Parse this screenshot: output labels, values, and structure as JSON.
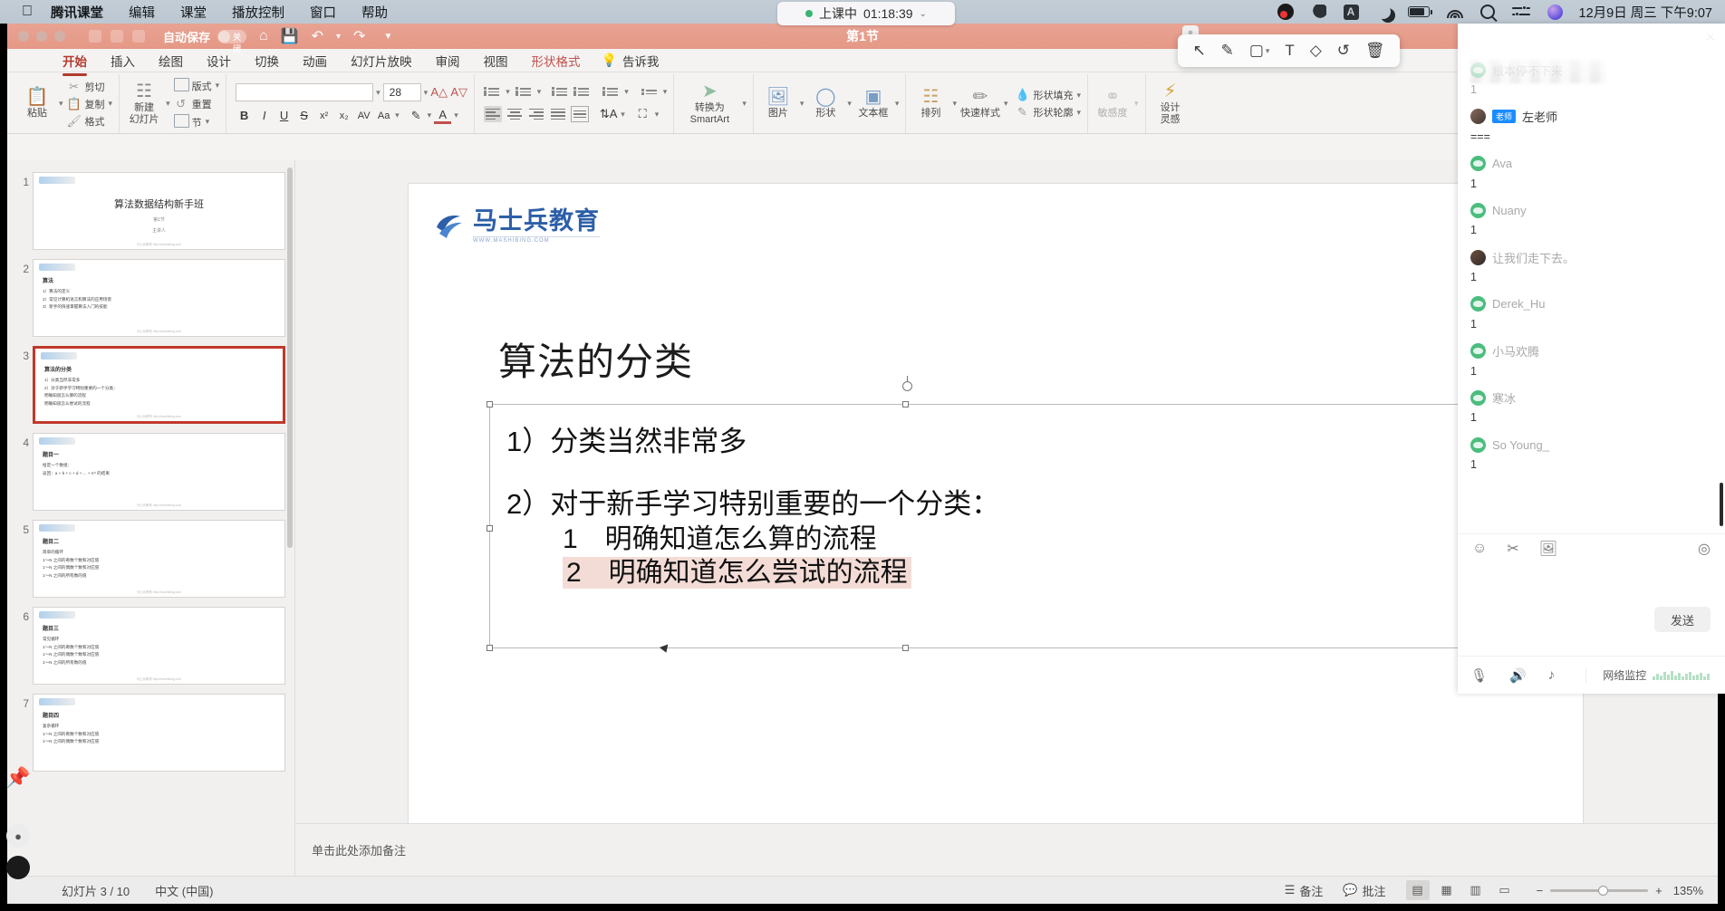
{
  "macbar": {
    "apple": "",
    "menus": [
      {
        "label": "腾讯课堂",
        "bold": true
      },
      {
        "label": "编辑",
        "bold": false
      },
      {
        "label": "课堂",
        "bold": false
      },
      {
        "label": "播放控制",
        "bold": false
      },
      {
        "label": "窗口",
        "bold": false
      },
      {
        "label": "帮助",
        "bold": false
      }
    ],
    "clock": "12月9日 周三 下午9:07"
  },
  "class_timer": {
    "status": "上课中",
    "elapsed": "01:18:39",
    "chevron": "⌄"
  },
  "ppt_window": {
    "autosave_label": "自动保存",
    "autosave_state": "关闭",
    "doc_title": "第1节",
    "tabs": [
      {
        "label": "开始",
        "active": true
      },
      {
        "label": "插入",
        "active": false
      },
      {
        "label": "绘图",
        "active": false
      },
      {
        "label": "设计",
        "active": false
      },
      {
        "label": "切换",
        "active": false
      },
      {
        "label": "动画",
        "active": false
      },
      {
        "label": "幻灯片放映",
        "active": false
      },
      {
        "label": "审阅",
        "active": false
      },
      {
        "label": "视图",
        "active": false
      }
    ],
    "shape_format_tab": "形状格式",
    "tell_me": "告诉我"
  },
  "ribbon": {
    "paste": "粘贴",
    "cut": "剪切",
    "copy": "复制",
    "format_painter": "格式",
    "new_slide": "新建\n幻灯片",
    "layout": "版式",
    "reset": "重置",
    "section": "节",
    "font_name": "",
    "font_size": "28",
    "bold": "B",
    "italic": "I",
    "underline": "U",
    "strike": "S",
    "shadow": "AB",
    "sub": "x₂",
    "sup": "x²",
    "clear_fmt": "Aa",
    "picture": "图片",
    "shape": "形状",
    "textbox": "文本框",
    "arrange": "排列",
    "quick_styles": "快速样式",
    "shape_fill": "形状填充",
    "shape_outline": "形状轮廓",
    "sensitivity": "敏感度",
    "design_ideas": "设计\n灵感",
    "convert_smartart": "转换为\nSmartArt"
  },
  "annotation_toolbar": {
    "tools": [
      {
        "name": "select-tool",
        "glyph": "↖"
      },
      {
        "name": "pen-tool",
        "glyph": "✎"
      },
      {
        "name": "shape-tool",
        "glyph": "▢"
      },
      {
        "name": "text-tool",
        "glyph": "T"
      },
      {
        "name": "eraser-tool",
        "glyph": "◇"
      },
      {
        "name": "undo-tool",
        "glyph": "↺"
      },
      {
        "name": "delete-tool",
        "glyph": "🗑"
      }
    ]
  },
  "thumbnails": [
    {
      "n": "1",
      "type": "title",
      "title": "算法数据结构新手班",
      "sub1": "第1节",
      "sub2": "主讲人",
      "selected": false
    },
    {
      "n": "2",
      "type": "bullets",
      "heading": "算法",
      "lines": [
        "1）算法的定义",
        "2）常见计算机语言和算法的应用场景",
        "3）新手的快速掌握算法入门的技能"
      ],
      "selected": false
    },
    {
      "n": "3",
      "type": "bullets",
      "heading": "算法的分类",
      "lines": [
        "1）分类当然非常多",
        "2）对于新手学习特别重要的一个分类：",
        "   明确知道怎么算的流程",
        "   明确知道怎么尝试的流程"
      ],
      "selected": true
    },
    {
      "n": "4",
      "type": "bullets",
      "heading": "题目一",
      "lines": [
        "给定一个数组：",
        "返回：a + b + c + d + ... + n? 的结果"
      ],
      "selected": false
    },
    {
      "n": "5",
      "type": "bullets",
      "heading": "题目二",
      "lines": [
        "简单的循环",
        "1～N 之间的奇数个数和对应值",
        "1～N 之间的偶数个数和对应值",
        "1～N 之间的所有数的值"
      ],
      "selected": false
    },
    {
      "n": "6",
      "type": "bullets",
      "heading": "题目三",
      "lines": [
        "常见循环",
        "1～N 之间的奇数个数和对应值",
        "1～N 之间的偶数个数和对应值",
        "1～N 之间的所有数的值"
      ],
      "selected": false
    },
    {
      "n": "7",
      "type": "bullets",
      "heading": "题目四",
      "lines": [
        "复杂循环",
        "1～N 之间的奇数个数和对应值",
        "1～N 之间的偶数个数和对应值"
      ],
      "selected": false
    }
  ],
  "slide": {
    "logo_text": "马士兵教育",
    "logo_url": "WWW.MASHIBING.COM",
    "title": "算法的分类",
    "lines": [
      {
        "text": "1）分类当然非常多",
        "indent": false,
        "gap": false,
        "highlight": false
      },
      {
        "text": "2）对于新手学习特别重要的一个分类：",
        "indent": false,
        "gap": true,
        "highlight": false
      },
      {
        "text": "1　明确知道怎么算的流程",
        "indent": true,
        "gap": false,
        "highlight": false
      },
      {
        "text": "2　明确知道怎么尝试的流程",
        "indent": true,
        "gap": false,
        "highlight": true
      }
    ],
    "footer": "马士兵教育 http://mashibing.com"
  },
  "notes": {
    "placeholder": "单击此处添加备注"
  },
  "status_bar": {
    "slide_counter": "幻灯片 3 / 10",
    "language": "中文 (中国)",
    "notes_btn": "备注",
    "comments_btn": "批注",
    "views": [
      {
        "name": "normal-view",
        "glyph": "▤",
        "selected": true
      },
      {
        "name": "slide-sorter-view",
        "glyph": "▦",
        "selected": false
      },
      {
        "name": "reading-view",
        "glyph": "▥",
        "selected": false
      },
      {
        "name": "slideshow-view",
        "glyph": "▭",
        "selected": false
      }
    ],
    "zoom_out": "−",
    "zoom_in": "+",
    "zoom_pct": "135%"
  },
  "chat": {
    "close_glyph": "✕",
    "messages": [
      {
        "avatar": "wechat",
        "badge": "",
        "name": "根本停不下来",
        "text": "1",
        "faded": true
      },
      {
        "avatar": "photo",
        "badge": "老师",
        "name": "左老师",
        "text": "===",
        "teacher": true
      },
      {
        "avatar": "wechat",
        "badge": "",
        "name": "Ava",
        "text": "1"
      },
      {
        "avatar": "wechat",
        "badge": "",
        "name": "Nuany",
        "text": "1"
      },
      {
        "avatar": "photo2",
        "badge": "",
        "name": "让我们走下去。",
        "text": "1"
      },
      {
        "avatar": "wechat",
        "badge": "",
        "name": "Derek_Hu",
        "text": "1"
      },
      {
        "avatar": "wechat",
        "badge": "",
        "name": "小马欢腾",
        "text": "1"
      },
      {
        "avatar": "wechat",
        "badge": "",
        "name": "寒冰",
        "text": "1"
      },
      {
        "avatar": "wechat",
        "badge": "",
        "name": "So Young_",
        "text": "1"
      }
    ],
    "tools": [
      {
        "name": "emoji-icon",
        "glyph": "☺"
      },
      {
        "name": "scissors-icon",
        "glyph": "✂"
      },
      {
        "name": "image-icon",
        "glyph": "🖼"
      }
    ],
    "settings_glyph": "◎",
    "send_label": "发送",
    "footer_tools": [
      {
        "name": "microphone-icon",
        "glyph": "🎙"
      },
      {
        "name": "speaker-icon",
        "glyph": "🔊"
      },
      {
        "name": "music-icon",
        "glyph": "♪"
      }
    ],
    "network_label": "网络监控"
  },
  "colors": {
    "titlebar": "#e59886",
    "accent": "#b23b2e",
    "highlight": "#f4dcd6",
    "selected_thumb_border": "#c0392b",
    "brand_blue": "#2d5fa8",
    "wechat_green": "#4bbd7e"
  }
}
